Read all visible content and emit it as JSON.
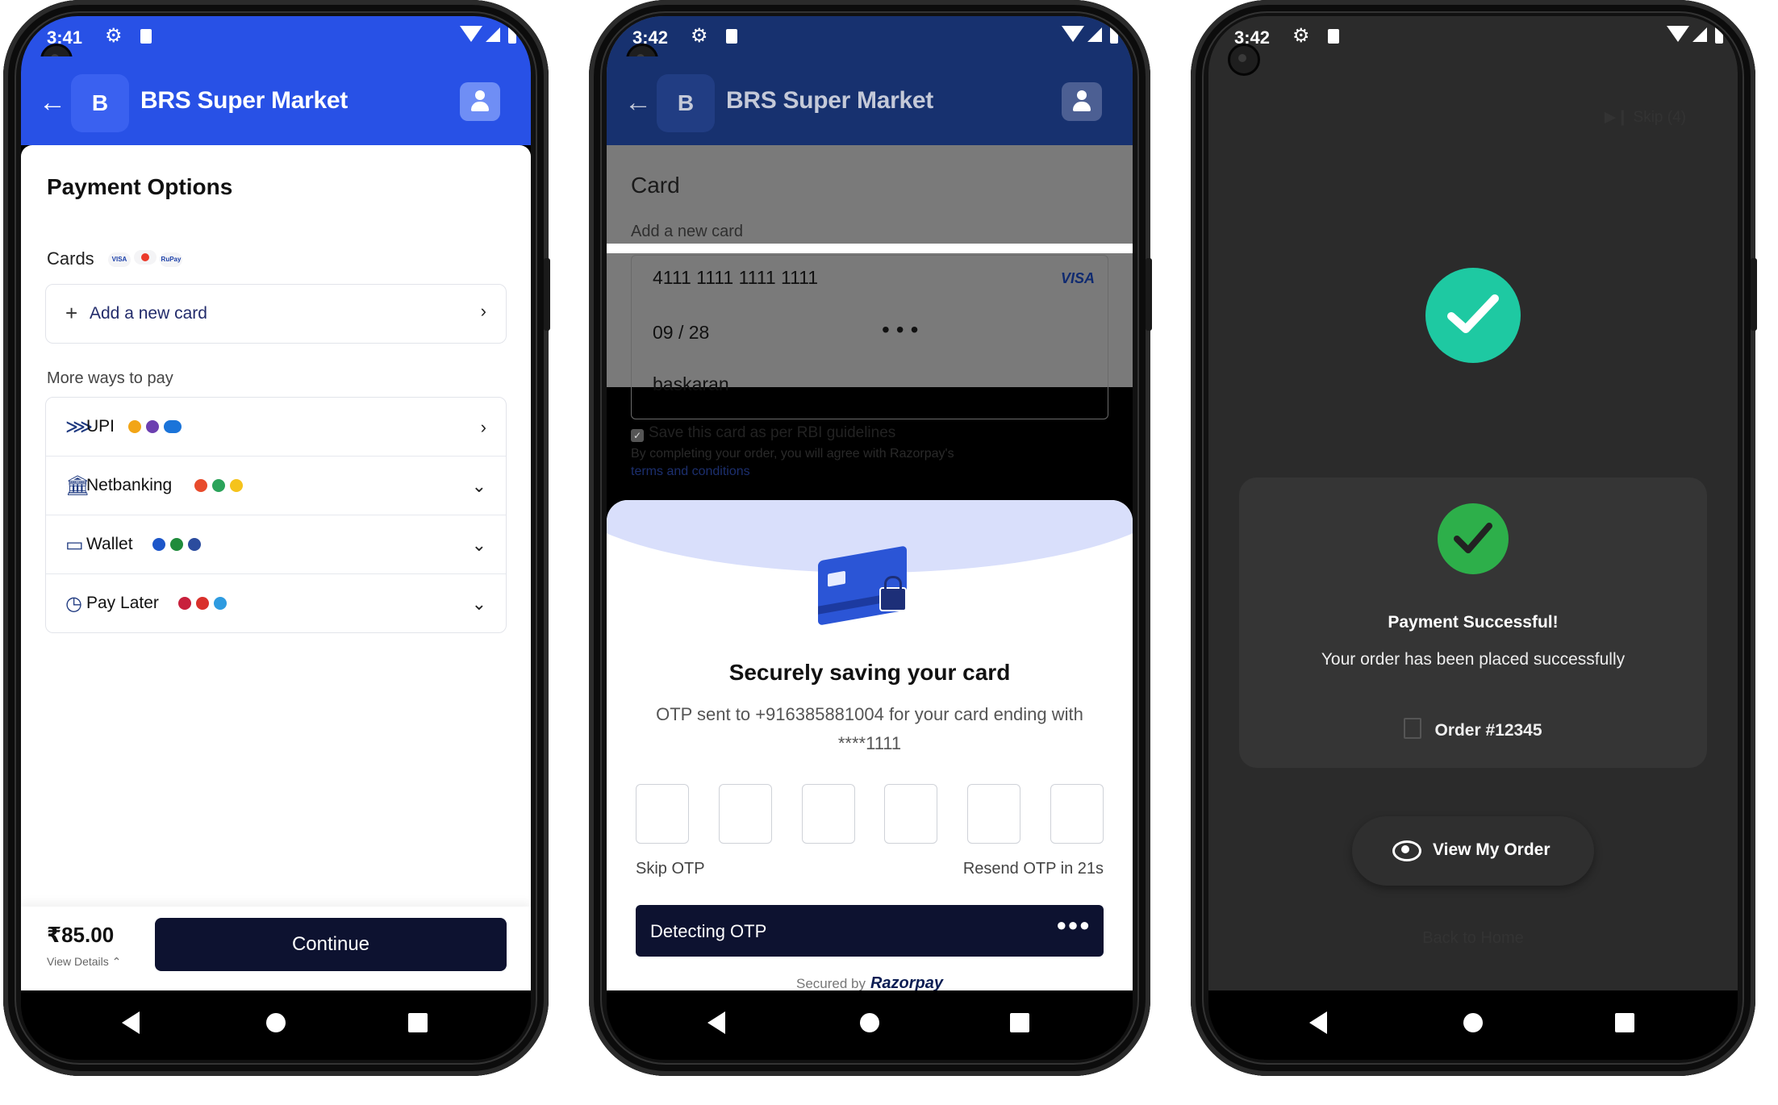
{
  "phone1": {
    "status_time": "3:41",
    "store_initial": "B",
    "store_name": "BRS Super Market",
    "page_title": "Payment Options",
    "cards_label": "Cards",
    "card_logos": [
      "VISA",
      "mastercard",
      "RuPay"
    ],
    "add_card_label": "Add a new card",
    "more_ways_label": "More ways to pay",
    "methods": [
      {
        "label": "UPI",
        "icon": "upi-icon",
        "chevron": "›",
        "logo_colors": [
          "#f2a516",
          "#6c3fb0",
          "#1b74d9"
        ]
      },
      {
        "label": "Netbanking",
        "icon": "bank-icon",
        "chevron": "⌄",
        "logo_colors": [
          "#e84b2c",
          "#2ba35a",
          "#f5c31c"
        ]
      },
      {
        "label": "Wallet",
        "icon": "wallet-icon",
        "chevron": "⌄",
        "logo_colors": [
          "#1c56c9",
          "#1f8b3b",
          "#2b4c9e"
        ]
      },
      {
        "label": "Pay Later",
        "icon": "clock-icon",
        "chevron": "⌄",
        "logo_colors": [
          "#c8203c",
          "#d9302b",
          "#2e9be0"
        ]
      }
    ],
    "price": "₹85.00",
    "view_details": "View Details",
    "continue_label": "Continue"
  },
  "phone2": {
    "status_time": "3:42",
    "store_initial": "B",
    "store_name": "BRS Super Market",
    "card_title": "Card",
    "card_sub": "Add a new card",
    "card_number": "4111 1111 1111 1111",
    "card_brand": "VISA",
    "card_expiry": "09 / 28",
    "card_cvv": "•••",
    "card_holder": "baskaran",
    "save_label": "Save this card as per RBI guidelines",
    "agree_text": "By completing your order, you will agree with Razorpay's",
    "terms_text": "terms and conditions",
    "secure_title": "Securely saving your card",
    "secure_desc": "OTP sent to +916385881004 for your card ending with ****1111",
    "skip_otp": "Skip OTP",
    "resend_otp": "Resend OTP in 21s",
    "detecting_label": "Detecting OTP",
    "secured_by": "Secured by",
    "razorpay": "Razorpay"
  },
  "phone3": {
    "status_time": "3:42",
    "skip_label": "Skip (4)",
    "success_title": "Payment Successful!",
    "success_desc": "Your order has been placed successfully",
    "order_number": "Order #12345",
    "view_order_label": "View My Order",
    "back_home_label": "Back to Home",
    "accent_color": "#1ec9a2",
    "check_color": "#2daf4a"
  }
}
